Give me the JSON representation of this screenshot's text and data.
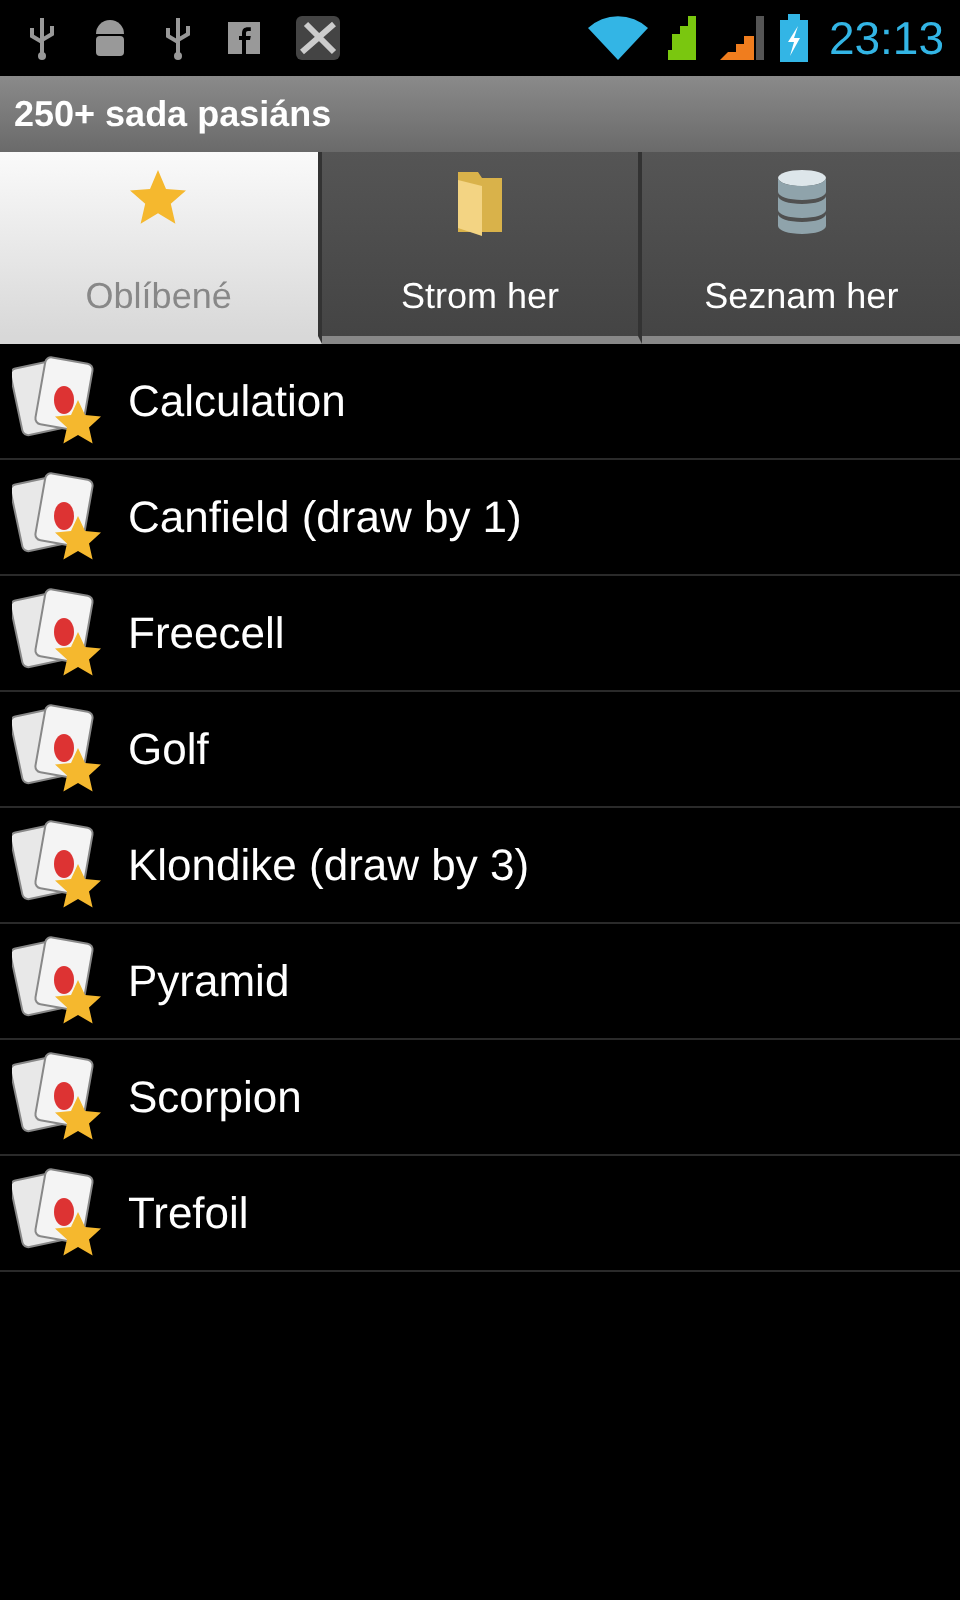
{
  "status_bar": {
    "time": "23:13"
  },
  "app_title": "250+ sada pasiáns",
  "tabs": [
    {
      "label": "Oblíbené",
      "selected": true,
      "kind": "star"
    },
    {
      "label": "Strom her",
      "selected": false,
      "kind": "folder"
    },
    {
      "label": "Seznam her",
      "selected": false,
      "kind": "database"
    }
  ],
  "games": [
    {
      "name": "Calculation"
    },
    {
      "name": "Canfield (draw by 1)"
    },
    {
      "name": "Freecell"
    },
    {
      "name": "Golf"
    },
    {
      "name": "Klondike (draw by 3)"
    },
    {
      "name": "Pyramid"
    },
    {
      "name": "Scorpion"
    },
    {
      "name": "Trefoil"
    }
  ]
}
